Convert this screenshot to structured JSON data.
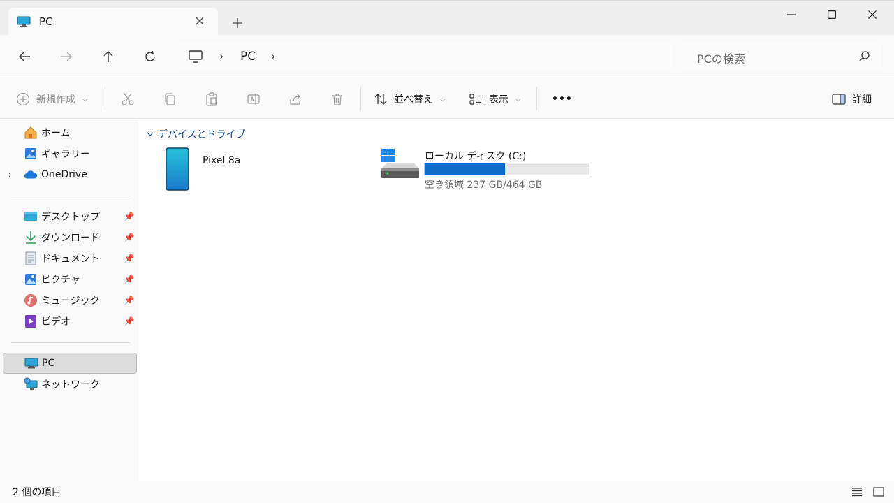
{
  "tab": {
    "title": "PC",
    "close_icon": "close-icon"
  },
  "window": {
    "minimize": "minimize-icon",
    "maximize": "maximize-icon",
    "close": "close-icon"
  },
  "address": {
    "segments": [
      "PC"
    ]
  },
  "search": {
    "placeholder": "PCの検索"
  },
  "commands": {
    "new": "新規作成",
    "sort": "並べ替え",
    "view": "表示",
    "more": "•••",
    "details": "詳細"
  },
  "sidebar": {
    "quick": [
      {
        "label": "ホーム",
        "icon": "home-icon"
      },
      {
        "label": "ギャラリー",
        "icon": "gallery-icon"
      },
      {
        "label": "OneDrive",
        "icon": "onedrive-cloud-icon"
      }
    ],
    "pinned": [
      {
        "label": "デスクトップ",
        "icon": "desktop-folder-icon"
      },
      {
        "label": "ダウンロード",
        "icon": "download-icon"
      },
      {
        "label": "ドキュメント",
        "icon": "document-icon"
      },
      {
        "label": "ピクチャ",
        "icon": "pictures-icon"
      },
      {
        "label": "ミュージック",
        "icon": "music-icon"
      },
      {
        "label": "ビデオ",
        "icon": "video-icon"
      }
    ],
    "system": [
      {
        "label": "PC",
        "icon": "pc-icon",
        "selected": true
      },
      {
        "label": "ネットワーク",
        "icon": "network-icon"
      }
    ]
  },
  "content": {
    "group_title": "デバイスとドライブ",
    "device": {
      "name": "Pixel 8a",
      "icon": "phone-icon"
    },
    "drive": {
      "name": "ローカル ディスク (C:)",
      "free_text": "空き領域 237 GB/464 GB",
      "used_fraction": 0.489,
      "icon": "windows-drive-icon",
      "bar_color": "#0b6fc9"
    }
  },
  "status": {
    "count": "2 個の項目"
  }
}
